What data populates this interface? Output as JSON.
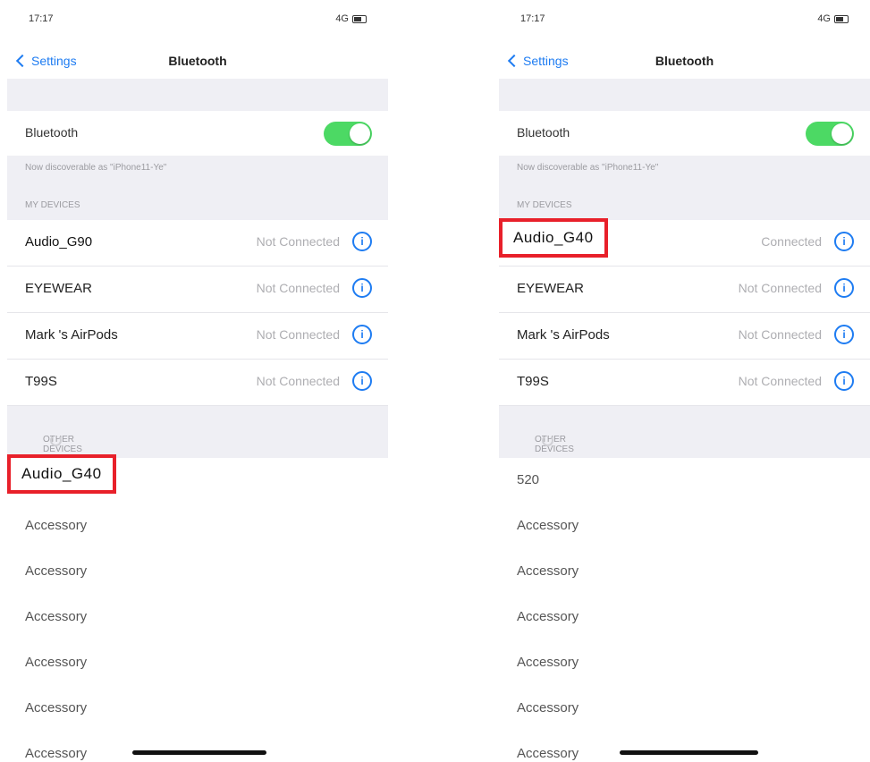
{
  "left": {
    "status": {
      "time": "17:17",
      "network": "4G"
    },
    "nav": {
      "back_label": "Settings",
      "title": "Bluetooth"
    },
    "bluetooth": {
      "label": "Bluetooth",
      "toggle_on": true
    },
    "discoverable_text": "Now discoverable as \"iPhone11-Ye\"",
    "my_devices": {
      "header": "MY DEVICES",
      "items": [
        {
          "name": "Audio_G90",
          "status": "Not Connected"
        },
        {
          "name": "EYEWEAR",
          "status": "Not Connected"
        },
        {
          "name": "Mark 's AirPods",
          "status": "Not Connected"
        },
        {
          "name": "T99S",
          "status": "Not Connected"
        }
      ]
    },
    "other_devices": {
      "header": "OTHER DEVICES",
      "items": [
        "Audio_G40",
        "Accessory",
        "Accessory",
        "Accessory",
        "Accessory",
        "Accessory",
        "Accessory"
      ]
    }
  },
  "right": {
    "status": {
      "time": "17:17",
      "network": "4G"
    },
    "nav": {
      "back_label": "Settings",
      "title": "Bluetooth"
    },
    "bluetooth": {
      "label": "Bluetooth",
      "toggle_on": true
    },
    "discoverable_text": "Now discoverable as \"iPhone11-Ye\"",
    "my_devices": {
      "header": "MY DEVICES",
      "items": [
        {
          "name": "Audio_G40",
          "status": "Connected"
        },
        {
          "name": "EYEWEAR",
          "status": "Not Connected"
        },
        {
          "name": "Mark 's AirPods",
          "status": "Not Connected"
        },
        {
          "name": "T99S",
          "status": "Not Connected"
        }
      ]
    },
    "other_devices": {
      "header": "OTHER DEVICES",
      "items": [
        "520",
        "Accessory",
        "Accessory",
        "Accessory",
        "Accessory",
        "Accessory",
        "Accessory"
      ]
    }
  },
  "icons": {
    "info": "info-circle-icon",
    "back": "chevron-left-icon",
    "spinner": "loading-spinner-icon"
  },
  "colors": {
    "accent": "#1e7cf2",
    "toggle_on": "#4cd964",
    "highlight_box": "#e8202a"
  }
}
